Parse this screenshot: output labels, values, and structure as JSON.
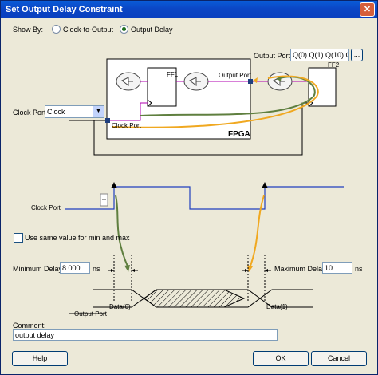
{
  "window": {
    "title": "Set Output Delay Constraint",
    "close_glyph": "✕"
  },
  "show_by": {
    "label": "Show By:",
    "options": [
      "Clock-to-Output",
      "Output Delay"
    ],
    "selected": "Output Delay"
  },
  "output_port": {
    "label": "Output Port:",
    "value": "Q(0) Q(1) Q(10) Q(",
    "browse_label": "..."
  },
  "clock_port": {
    "label": "Clock Port:",
    "value": "Clock"
  },
  "schematic": {
    "ff1": "FF1",
    "ff2": "FF2",
    "fpga": "FPGA",
    "output_port_label": "Output Port",
    "clock_port_label": "Clock Port"
  },
  "waveform": {
    "clock_port_label": "Clock Port",
    "output_port_label": "Output Port",
    "data0": "Data(0)",
    "data1": "Data(1)"
  },
  "same_value": {
    "label": "Use same value for min and max",
    "checked": false
  },
  "min_delay": {
    "label": "Minimum Delay:",
    "value": "8.000",
    "unit": "ns"
  },
  "max_delay": {
    "label": "Maximum Delay:",
    "value": "10",
    "unit": "ns"
  },
  "comment": {
    "label": "Comment:",
    "value": "output delay"
  },
  "buttons": {
    "help": "Help",
    "ok": "OK",
    "cancel": "Cancel"
  },
  "colors": {
    "accent_green": "#5f7f3f",
    "accent_orange": "#f0a820",
    "purple": "#b000b0",
    "blue_wave": "#1f3fbf"
  }
}
